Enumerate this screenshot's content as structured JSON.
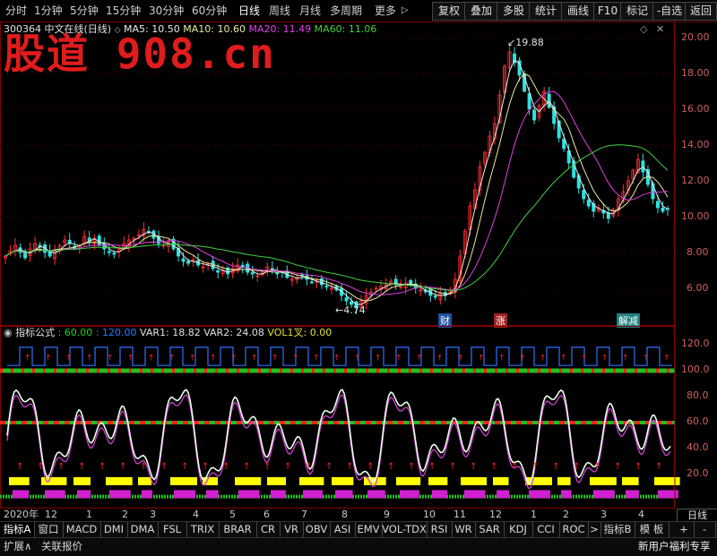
{
  "toolbar": {
    "periods": [
      "分时",
      "1分钟",
      "5分钟",
      "15分钟",
      "30分钟",
      "60分钟",
      "日线",
      "周线",
      "月线",
      "多周期",
      "更多"
    ],
    "more_arrow": "▷",
    "active_period": "日线",
    "buttons": [
      "复权",
      "叠加",
      "多股",
      "统计",
      "画线",
      "F10",
      "标记",
      "-自选",
      "返回"
    ]
  },
  "stock": {
    "code": "300364",
    "name": "中文在线",
    "period_label": "(日线)",
    "ma": [
      {
        "label": "MA5: 10.50",
        "color": "#e8e8e8"
      },
      {
        "label": "MA10: 10.60",
        "color": "#e8e8a0"
      },
      {
        "label": "MA20: 11.49",
        "color": "#e040e0"
      },
      {
        "label": "MA60: 11.06",
        "color": "#40d040"
      }
    ],
    "high_label": "19.88",
    "low_label": "4.74",
    "markers": [
      "财",
      "涨",
      "解减"
    ],
    "watermark": "股道 908.cn"
  },
  "price_axis": [
    "20.00",
    "18.00",
    "16.00",
    "14.00",
    "12.00",
    "10.00",
    "8.00",
    "6.00"
  ],
  "indicator": {
    "name": "指标公式",
    "values": [
      {
        "label": ": 60.00",
        "color": "#20d020"
      },
      {
        "label": ": 120.00",
        "color": "#2080ff"
      },
      {
        "label": "VAR1: 18.82",
        "color": "#e0e0e0"
      },
      {
        "label": "VAR2: 24.08",
        "color": "#e0e0e0"
      },
      {
        "label": "VOL1叉: 0.00",
        "color": "#e0e040"
      }
    ],
    "axis": [
      "120.0",
      "100.0",
      "80.0",
      "60.0",
      "40.0",
      "20.0"
    ]
  },
  "dates": [
    "2020年",
    "12",
    "1",
    "2",
    "3",
    "4",
    "5",
    "6",
    "7",
    "8",
    "9",
    "10",
    "11",
    "12",
    "1",
    "2",
    "3",
    "4"
  ],
  "tabs": [
    "指标A",
    "窗口",
    "MACD",
    "DMI",
    "DMA",
    "FSL",
    "TRIX",
    "BRAR",
    "CR",
    "VR",
    "OBV",
    "ASI",
    "EMV",
    "VOL-TDX",
    "RSI",
    "WR",
    "SAR",
    "KDJ",
    "CCI",
    "ROC",
    ">",
    "指标B",
    "模 板"
  ],
  "tab_right": [
    "+",
    "-"
  ],
  "period_box": "日线",
  "bottom": {
    "left": [
      "扩展∧",
      "关联报价"
    ],
    "right": "新用户福利专享"
  },
  "colors": {
    "up": "#ff3030",
    "down": "#30e0e0",
    "grid": "#800000",
    "ma5": "#e8e8e8",
    "ma10": "#e8e8a0",
    "ma20": "#e040e0",
    "ma60": "#40d040"
  },
  "chart_data": {
    "type": "candlestick",
    "ylim": [
      4,
      21
    ],
    "close": [
      7.8,
      8.1,
      8.4,
      8.0,
      7.7,
      8.2,
      8.5,
      8.3,
      8.0,
      7.8,
      8.1,
      8.4,
      8.7,
      8.5,
      8.2,
      8.4,
      8.9,
      8.6,
      8.8,
      8.4,
      8.2,
      8.0,
      7.9,
      8.2,
      8.5,
      8.7,
      8.8,
      9.0,
      9.3,
      9.1,
      8.8,
      8.5,
      8.4,
      8.6,
      8.2,
      7.8,
      7.5,
      7.4,
      7.6,
      7.3,
      7.2,
      7.4,
      7.1,
      6.9,
      7.0,
      6.8,
      7.1,
      7.3,
      7.2,
      6.9,
      6.8,
      6.7,
      6.9,
      7.2,
      7.0,
      6.8,
      6.9,
      6.6,
      6.5,
      6.6,
      6.7,
      6.5,
      6.3,
      6.4,
      6.2,
      6.1,
      6.0,
      5.9,
      5.6,
      5.3,
      5.1,
      4.9,
      5.3,
      5.6,
      5.8,
      6.0,
      6.1,
      6.2,
      6.4,
      6.2,
      6.1,
      6.3,
      6.2,
      6.0,
      5.9,
      5.8,
      5.6,
      5.5,
      5.7,
      5.6,
      5.9,
      6.5,
      7.8,
      9.2,
      10.6,
      11.5,
      12.8,
      13.6,
      14.5,
      15.2,
      16.8,
      18.4,
      19.2,
      18.6,
      17.9,
      17.0,
      16.0,
      15.4,
      16.2,
      17.0,
      16.1,
      15.2,
      14.4,
      13.8,
      13.0,
      12.2,
      11.6,
      11.0,
      10.6,
      10.3,
      10.5,
      10.2,
      9.9,
      10.4,
      11.0,
      11.4,
      12.0,
      12.6,
      13.2,
      12.5,
      11.8,
      11.0,
      10.5,
      10.3,
      10.4
    ],
    "high_mark": 19.88,
    "low_mark": 4.74
  }
}
